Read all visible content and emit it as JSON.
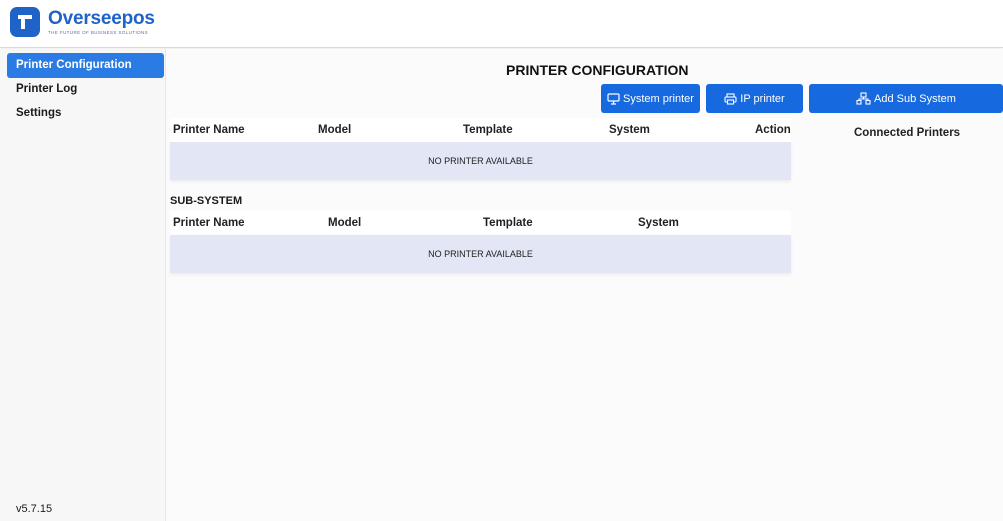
{
  "header": {
    "app_name": "Overseepos",
    "tagline": "THE FUTURE OF BUSINESS SOLUTIONS"
  },
  "sidebar": {
    "items": [
      {
        "label": "Printer Configuration",
        "active": true
      },
      {
        "label": "Printer Log",
        "active": false
      },
      {
        "label": "Settings",
        "active": false
      }
    ],
    "version": "v5.7.15"
  },
  "main": {
    "title": "PRINTER CONFIGURATION",
    "buttons": {
      "system_printer": "System printer",
      "ip_printer": "IP printer",
      "add_sub_system": "Add Sub System"
    },
    "printers_table": {
      "columns": [
        "Printer Name",
        "Model",
        "Template",
        "System",
        "Action"
      ],
      "empty_message": "NO PRINTER AVAILABLE"
    },
    "sub_system": {
      "title": "SUB-SYSTEM",
      "columns": [
        "Printer Name",
        "Model",
        "Template",
        "System"
      ],
      "empty_message": "NO PRINTER AVAILABLE"
    },
    "connected_printers_title": "Connected Printers"
  },
  "colors": {
    "brand": "#1f63c9",
    "accent_button": "#1769e0",
    "sidebar_active": "#2a7be4",
    "empty_row": "#e2e6f5"
  }
}
